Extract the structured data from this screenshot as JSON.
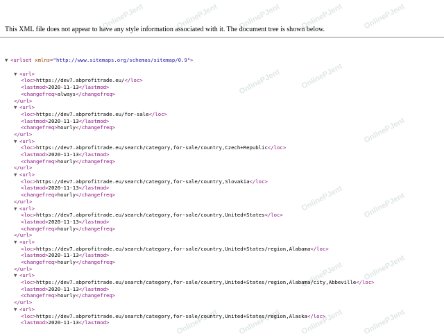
{
  "notice": "This XML file does not appear to have any style information associated with it. The document tree is shown below.",
  "watermark_text": "OnlinePJent",
  "root": {
    "open": "<urlset",
    "attr_name": "xmlns",
    "attr_value": "\"http://www.sitemaps.org/schemas/sitemap/0.9\"",
    "open_end": ">"
  },
  "tags": {
    "url_open": "<url>",
    "url_close": "</url>",
    "loc_open": "<loc>",
    "loc_close": "</loc>",
    "lastmod_open": "<lastmod>",
    "lastmod_close": "</lastmod>",
    "changefreq_open": "<changefreq>",
    "changefreq_close": "</changefreq>"
  },
  "toggle_glyph": "▼",
  "urls": [
    {
      "loc": "https://dev7.abprofitrade.eu/",
      "lastmod": "2020-11-13",
      "changefreq": "always"
    },
    {
      "loc": "https://dev7.abprofitrade.eu/for-sale",
      "lastmod": "2020-11-13",
      "changefreq": "hourly"
    },
    {
      "loc": "https://dev7.abprofitrade.eu/search/category,for-sale/country,Czech+Republic",
      "lastmod": "2020-11-13",
      "changefreq": "hourly"
    },
    {
      "loc": "https://dev7.abprofitrade.eu/search/category,for-sale/country,Slovakia",
      "lastmod": "2020-11-13",
      "changefreq": "hourly"
    },
    {
      "loc": "https://dev7.abprofitrade.eu/search/category,for-sale/country,United+States",
      "lastmod": "2020-11-13",
      "changefreq": "hourly"
    },
    {
      "loc": "https://dev7.abprofitrade.eu/search/category,for-sale/country,United+States/region,Alabama",
      "lastmod": "2020-11-13",
      "changefreq": "hourly"
    },
    {
      "loc": "https://dev7.abprofitrade.eu/search/category,for-sale/country,United+States/region,Alabama/city,Abbeville",
      "lastmod": "2020-11-13",
      "changefreq": "hourly"
    },
    {
      "loc": "https://dev7.abprofitrade.eu/search/category,for-sale/country,United+States/region,Alaska",
      "lastmod": "2020-11-13",
      "changefreq": null
    }
  ]
}
